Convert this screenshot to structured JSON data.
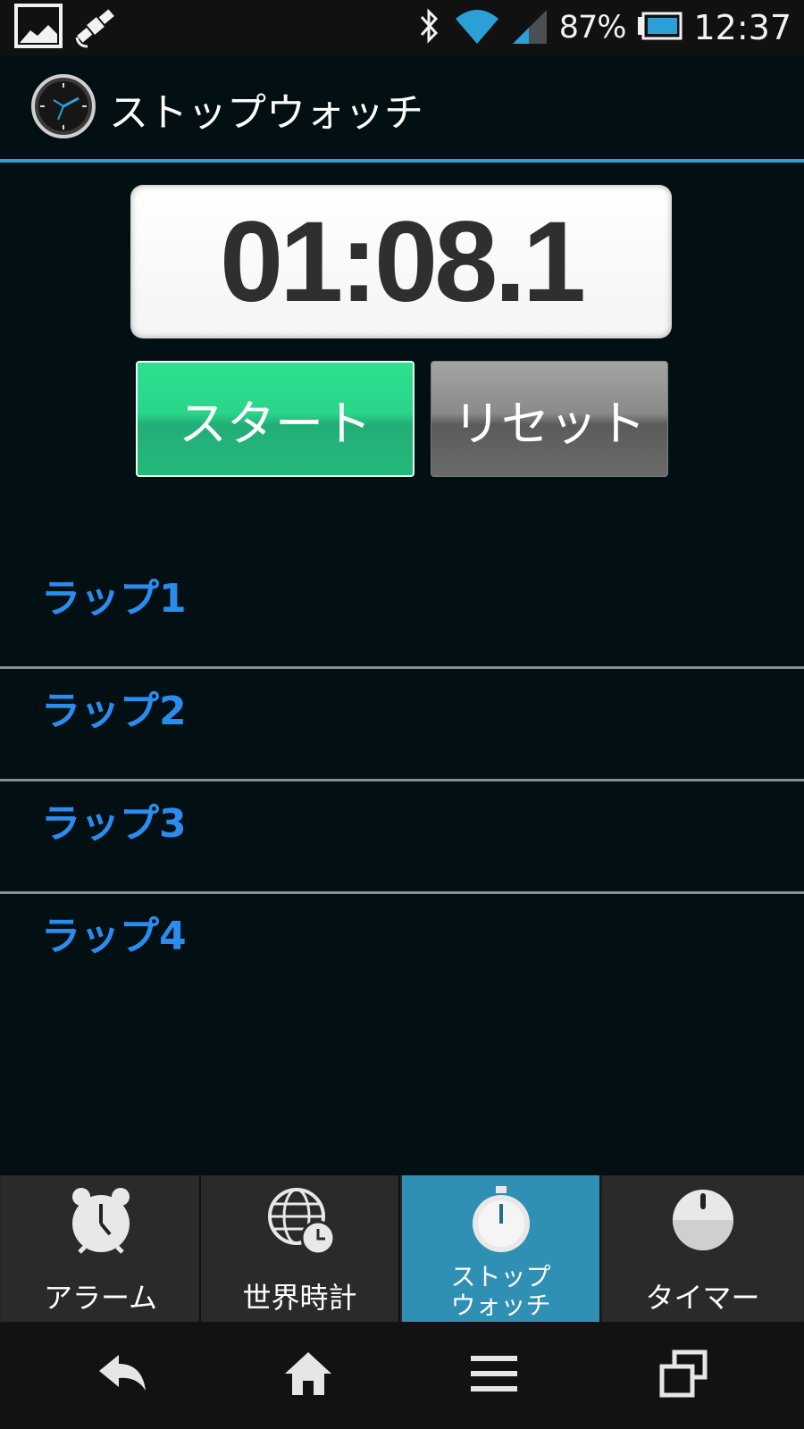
{
  "status_bar": {
    "battery_percent": "87%",
    "time": "12:37",
    "icons": [
      "image-icon",
      "gps-satellite-icon",
      "bluetooth-icon",
      "wifi-icon",
      "signal-icon",
      "battery-icon"
    ]
  },
  "app_bar": {
    "title": "ストップウォッチ",
    "icon": "clock-icon"
  },
  "stopwatch": {
    "display": "01:08.1",
    "start_label": "スタート",
    "reset_label": "リセット"
  },
  "laps": [
    {
      "label": "ラップ1"
    },
    {
      "label": "ラップ2"
    },
    {
      "label": "ラップ3"
    },
    {
      "label": "ラップ4"
    }
  ],
  "tabs": [
    {
      "label": "アラーム",
      "icon": "alarm-clock-icon",
      "active": false
    },
    {
      "label": "世界時計",
      "icon": "world-clock-icon",
      "active": false
    },
    {
      "label_line1": "ストップ",
      "label_line2": "ウォッチ",
      "icon": "stopwatch-icon",
      "active": true
    },
    {
      "label": "タイマー",
      "icon": "timer-icon",
      "active": false
    }
  ],
  "nav_bar": {
    "icons": [
      "back-icon",
      "home-icon",
      "menu-icon",
      "recent-apps-icon"
    ]
  },
  "colors": {
    "accent": "#2aa0d6",
    "start_button": "#2ad58a",
    "reset_button": "#7a7a7a",
    "lap_text": "#2b8cf0",
    "active_tab": "#3090b4",
    "background": "#020f13"
  }
}
